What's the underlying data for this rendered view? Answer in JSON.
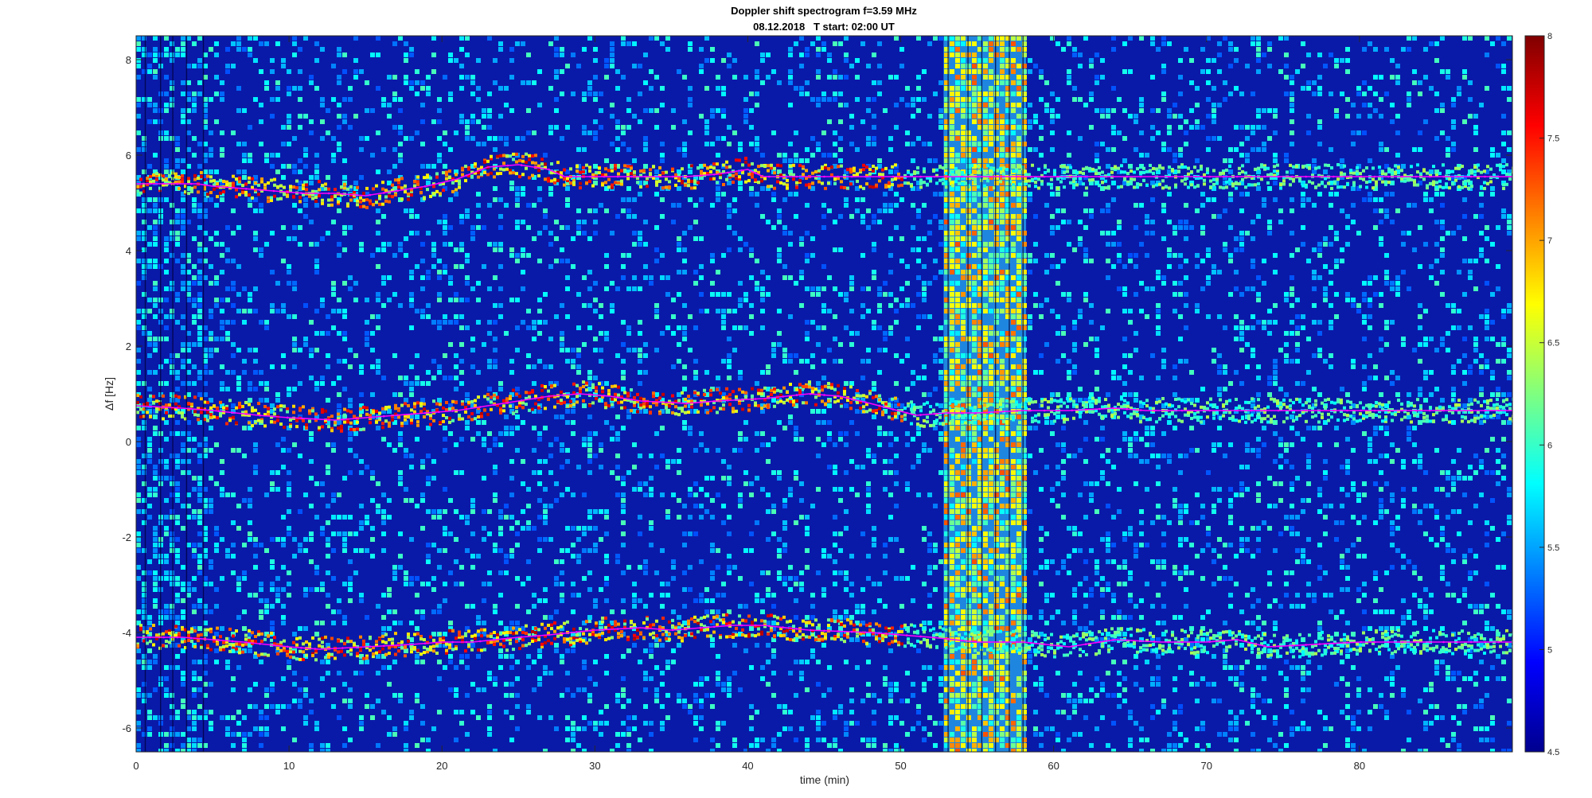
{
  "chart_data": {
    "type": "heatmap",
    "title": "Doppler shift spectrogram f=3.59 MHz",
    "subtitle": "08.12.2018   T start: 02:00 UT",
    "xlabel": "time (min)",
    "ylabel": "Δf [Hz]",
    "xlim": [
      0,
      90
    ],
    "ylim": [
      -6.5,
      8.5
    ],
    "xticks": [
      0,
      10,
      20,
      30,
      40,
      50,
      60,
      70,
      80
    ],
    "yticks": [
      8,
      6,
      4,
      2,
      0,
      -2,
      -4,
      -6
    ],
    "colorbar": {
      "colormap": "jet",
      "limits": [
        4.5,
        8
      ],
      "ticks": [
        8,
        7.5,
        7,
        6.5,
        6,
        5.5,
        5,
        4.5
      ]
    },
    "broadband_interference": {
      "x_range": [
        52.8,
        58.2
      ]
    },
    "series": [
      {
        "color": "#ff00ff",
        "x": [
          0,
          2,
          4,
          5,
          7,
          9,
          11,
          13,
          15,
          17,
          19,
          21,
          23,
          25,
          27,
          28,
          30,
          33,
          36,
          38,
          40,
          41,
          45,
          50,
          55,
          60,
          65,
          70,
          80,
          90
        ],
        "y": [
          5.4,
          5.4,
          5.4,
          5.35,
          5.3,
          5.25,
          5.2,
          5.2,
          5.15,
          5.25,
          5.35,
          5.5,
          5.75,
          5.8,
          5.7,
          5.55,
          5.55,
          5.55,
          5.55,
          5.6,
          5.7,
          5.55,
          5.55,
          5.55,
          5.55,
          5.55,
          5.55,
          5.55,
          5.55,
          5.55
        ]
      },
      {
        "color": "#ff00ff",
        "x": [
          0,
          3,
          5,
          8,
          10,
          13,
          15,
          17,
          19,
          21,
          23,
          25,
          27,
          29,
          31,
          33,
          36,
          38,
          41,
          44,
          46,
          48,
          51,
          53,
          55,
          58,
          61,
          64,
          66,
          70,
          80,
          90
        ],
        "y": [
          0.75,
          0.7,
          0.65,
          0.55,
          0.5,
          0.45,
          0.5,
          0.55,
          0.6,
          0.65,
          0.75,
          0.85,
          0.95,
          1.0,
          0.95,
          0.85,
          0.8,
          0.85,
          0.9,
          1.0,
          0.95,
          0.8,
          0.55,
          0.6,
          0.6,
          0.65,
          0.65,
          0.7,
          0.65,
          0.65,
          0.65,
          0.65
        ]
      },
      {
        "color": "#ff00ff",
        "x": [
          0,
          3,
          5,
          7,
          10,
          12,
          15,
          18,
          20,
          22,
          25,
          27,
          30,
          33,
          35,
          37,
          39,
          41,
          44,
          48,
          52,
          55,
          58,
          61,
          64,
          67,
          70,
          72,
          74,
          80,
          90
        ],
        "y": [
          -4.1,
          -4.1,
          -4.15,
          -4.2,
          -4.3,
          -4.35,
          -4.3,
          -4.25,
          -4.2,
          -4.2,
          -4.1,
          -4.05,
          -3.95,
          -3.9,
          -3.95,
          -3.9,
          -3.85,
          -3.85,
          -3.95,
          -4.0,
          -4.1,
          -4.2,
          -4.2,
          -4.3,
          -4.15,
          -4.2,
          -4.2,
          -4.15,
          -4.3,
          -4.2,
          -4.2
        ]
      }
    ]
  }
}
